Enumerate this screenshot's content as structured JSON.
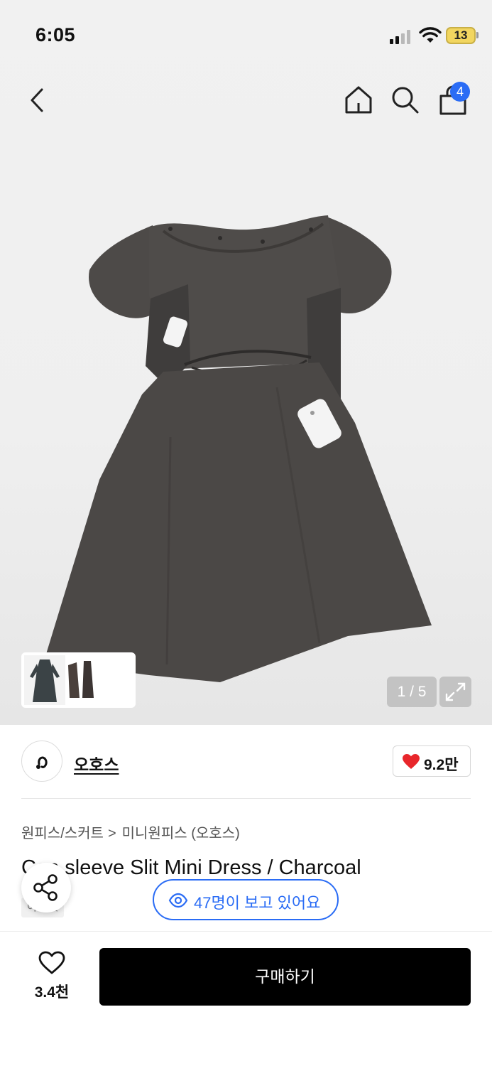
{
  "status_bar": {
    "time": "6:05",
    "battery": "13"
  },
  "header": {
    "cart_count": "4"
  },
  "gallery": {
    "pager": "1 / 5"
  },
  "brand": {
    "name": "오호스",
    "likes": "9.2만"
  },
  "breadcrumb": {
    "category": "원피스/스커트",
    "subcategory": "미니원피스 (오호스)",
    "separator": ">"
  },
  "product": {
    "title": "Cap sleeve Slit Mini Dress / Charcoal",
    "tag": "아울렛"
  },
  "viewing": {
    "text": "47명이 보고 있어요"
  },
  "footer": {
    "wish_count": "3.4천",
    "buy_label": "구매하기"
  },
  "colors": {
    "accent": "#2a6cf5",
    "heart": "#e8262b",
    "buy_button": "#000000",
    "dress": "#4a4745"
  }
}
